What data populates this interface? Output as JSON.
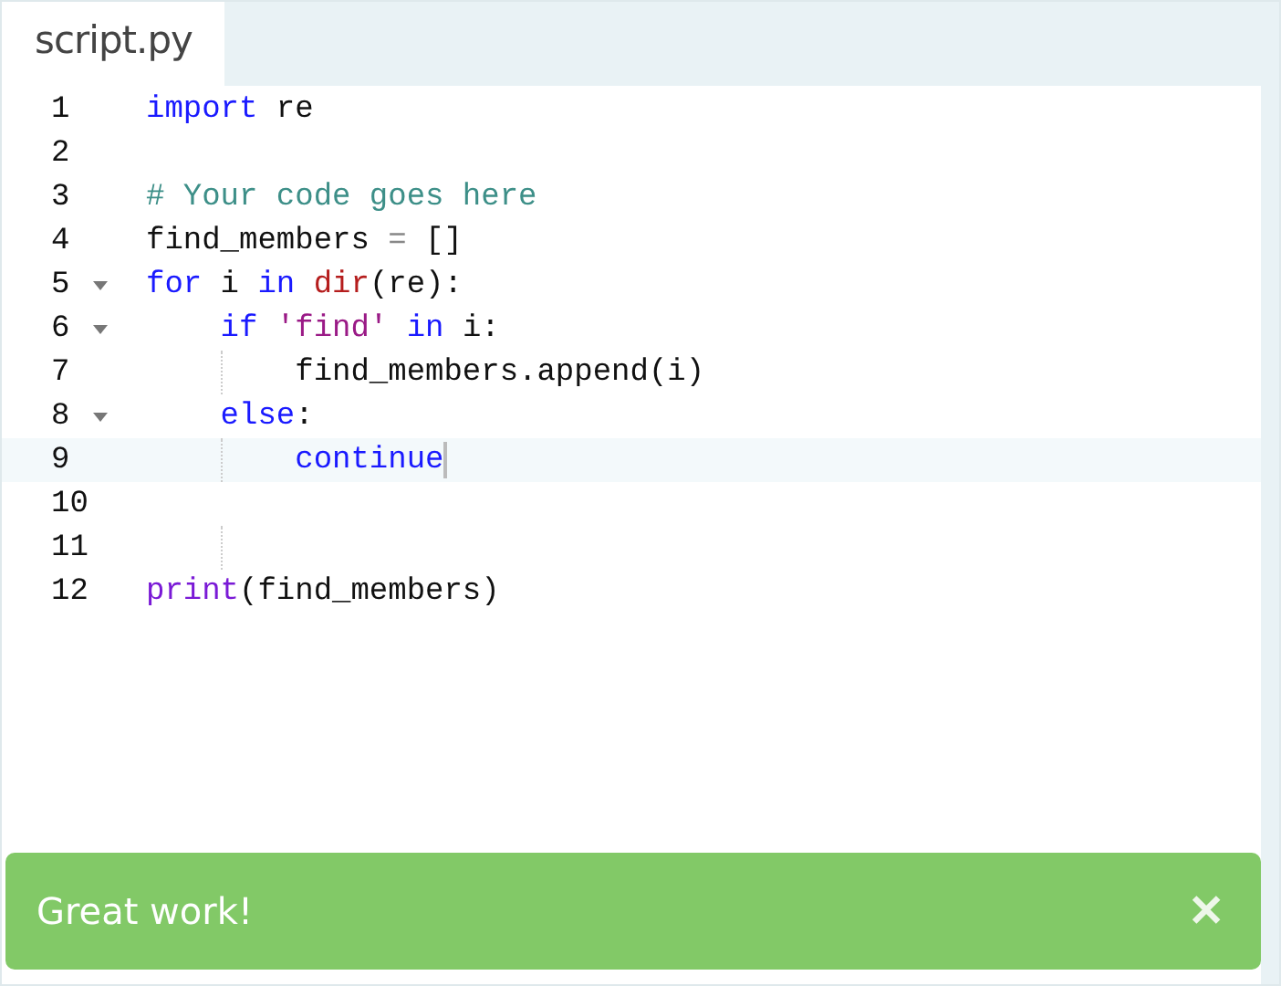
{
  "tabs": [
    {
      "label": "script.py",
      "selected": true
    }
  ],
  "editor": {
    "lines": [
      {
        "number": "1",
        "foldable": false,
        "guide": false,
        "active": false,
        "cursor": false,
        "tokens": [
          {
            "kind": "keyword",
            "text": "import"
          },
          {
            "kind": "plain",
            "text": " re"
          }
        ]
      },
      {
        "number": "2",
        "foldable": false,
        "guide": false,
        "active": false,
        "cursor": false
      },
      {
        "number": "3",
        "foldable": false,
        "guide": false,
        "active": false,
        "cursor": false,
        "tokens": [
          {
            "kind": "comment",
            "text": "# Your code goes here"
          }
        ]
      },
      {
        "number": "4",
        "foldable": false,
        "guide": false,
        "active": false,
        "cursor": false,
        "tokens": [
          {
            "kind": "plain",
            "text": "find_members "
          },
          {
            "kind": "operator",
            "text": "="
          },
          {
            "kind": "plain",
            "text": " []"
          }
        ]
      },
      {
        "number": "5",
        "foldable": true,
        "guide": false,
        "active": false,
        "cursor": false,
        "tokens": [
          {
            "kind": "keyword",
            "text": "for"
          },
          {
            "kind": "plain",
            "text": " i "
          },
          {
            "kind": "keyword",
            "text": "in"
          },
          {
            "kind": "builtin",
            "text": " dir"
          },
          {
            "kind": "plain",
            "text": "(re):"
          }
        ]
      },
      {
        "number": "6",
        "foldable": true,
        "guide": false,
        "active": false,
        "cursor": false,
        "tokens": [
          {
            "kind": "keyword",
            "text": "    if"
          },
          {
            "kind": "string",
            "text": " 'find'"
          },
          {
            "kind": "keyword",
            "text": " in"
          },
          {
            "kind": "plain",
            "text": " i:"
          }
        ]
      },
      {
        "number": "7",
        "foldable": false,
        "guide": true,
        "active": false,
        "cursor": false,
        "tokens": [
          {
            "kind": "plain",
            "text": "        find_members.append(i)"
          }
        ]
      },
      {
        "number": "8",
        "foldable": true,
        "guide": false,
        "active": false,
        "cursor": false,
        "tokens": [
          {
            "kind": "keyword",
            "text": "    else"
          },
          {
            "kind": "plain",
            "text": ":"
          }
        ]
      },
      {
        "number": "9",
        "foldable": false,
        "guide": true,
        "active": true,
        "cursor": true,
        "tokens": [
          {
            "kind": "keyword",
            "text": "        continue"
          }
        ]
      },
      {
        "number": "10",
        "foldable": false,
        "guide": false,
        "active": false,
        "cursor": false
      },
      {
        "number": "11",
        "foldable": false,
        "guide": true,
        "active": false,
        "cursor": false
      },
      {
        "number": "12",
        "foldable": false,
        "guide": false,
        "active": false,
        "cursor": false,
        "tokens": [
          {
            "kind": "function",
            "text": "print"
          },
          {
            "kind": "plain",
            "text": "(find_members)"
          }
        ]
      }
    ]
  },
  "banner": {
    "message": "Great work!",
    "close": "✕"
  }
}
